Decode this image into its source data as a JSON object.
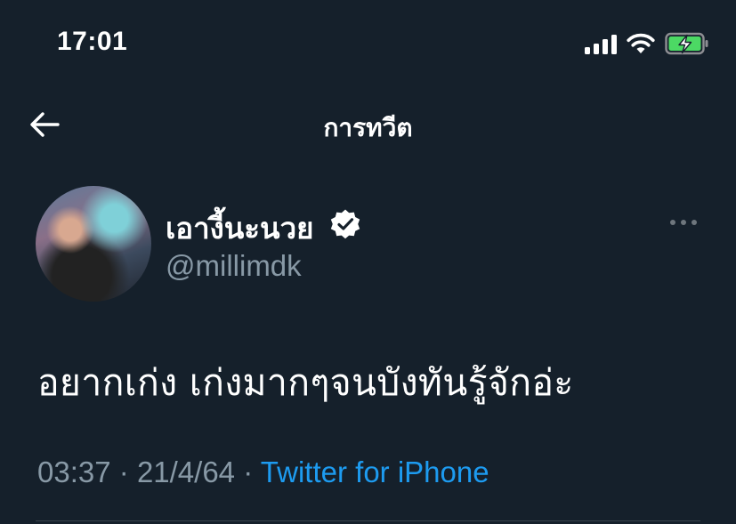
{
  "status_bar": {
    "time": "17:01",
    "signal_icon": "cellular-signal-icon",
    "wifi_icon": "wifi-icon",
    "battery_icon": "battery-charging-icon",
    "battery_color": "#4cd964"
  },
  "header": {
    "back_icon": "arrow-left-icon",
    "title": "การทวีต"
  },
  "author": {
    "name": "เอางี้นะนวย",
    "handle": "@millimdk",
    "verified": true,
    "verified_icon": "verified-badge-icon"
  },
  "tweet": {
    "text": "อยากเก่ง เก่งมากๆจนบังทันรู้จักอ่ะ",
    "time": "03:37",
    "date": "21/4/64",
    "source": "Twitter for iPhone",
    "separator": "·"
  },
  "colors": {
    "background": "#15202b",
    "secondary_text": "#8899a6",
    "link": "#1d9bf0",
    "divider": "#38444d"
  }
}
